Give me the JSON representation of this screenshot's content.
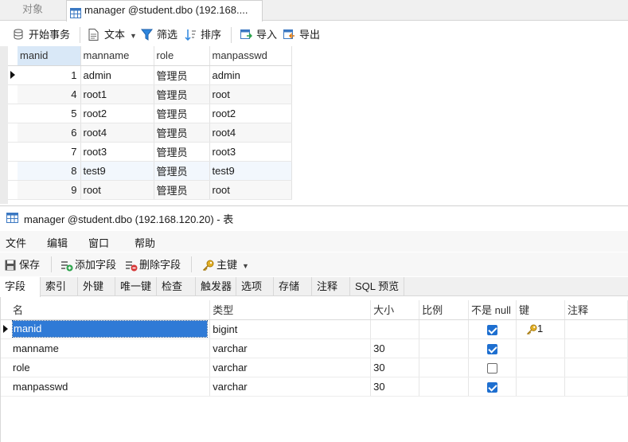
{
  "top_tabs": {
    "objects": "对象",
    "manager": "manager @student.dbo (192.168...."
  },
  "toolbar": {
    "begin_tx": "开始事务",
    "text": "文本",
    "filter": "筛选",
    "sort": "排序",
    "import": "导入",
    "export": "导出"
  },
  "grid": {
    "columns": [
      "manid",
      "manname",
      "role",
      "manpasswd"
    ],
    "rows": [
      [
        "1",
        "admin",
        "管理员",
        "admin"
      ],
      [
        "4",
        "root1",
        "管理员",
        "root"
      ],
      [
        "5",
        "root2",
        "管理员",
        "root2"
      ],
      [
        "6",
        "root4",
        "管理员",
        "root4"
      ],
      [
        "7",
        "root3",
        "管理员",
        "root3"
      ],
      [
        "8",
        "test9",
        "管理员",
        "test9"
      ],
      [
        "9",
        "root",
        "管理员",
        "root"
      ]
    ]
  },
  "design": {
    "title": "manager @student.dbo (192.168.120.20) - 表",
    "menu": [
      "文件",
      "编辑",
      "窗口",
      "帮助"
    ],
    "toolbar": {
      "save": "保存",
      "add_field": "添加字段",
      "delete_field": "删除字段",
      "primary_key": "主键"
    },
    "tabs": [
      "字段",
      "索引",
      "外键",
      "唯一键",
      "检查",
      "触发器",
      "选项",
      "存储",
      "注释",
      "SQL 预览"
    ],
    "field_columns": [
      "名",
      "类型",
      "大小",
      "比例",
      "不是 null",
      "键",
      "注释"
    ],
    "fields": [
      {
        "name": "manid",
        "type": "bigint",
        "size": "",
        "scale": "",
        "not_null": true,
        "key": "1",
        "comment": ""
      },
      {
        "name": "manname",
        "type": "varchar",
        "size": "30",
        "scale": "",
        "not_null": true,
        "key": "",
        "comment": ""
      },
      {
        "name": "role",
        "type": "varchar",
        "size": "30",
        "scale": "",
        "not_null": false,
        "key": "",
        "comment": ""
      },
      {
        "name": "manpasswd",
        "type": "varchar",
        "size": "30",
        "scale": "",
        "not_null": true,
        "key": "",
        "comment": ""
      }
    ]
  },
  "colors": {
    "accent": "#1e6fd0",
    "selection": "#2f7ad6",
    "key_gold": "#d9a520"
  },
  "icons": {
    "table": "table-icon",
    "begin_tx": "transaction-icon",
    "text": "document-icon",
    "filter": "funnel-icon",
    "sort": "sort-icon",
    "import": "import-icon",
    "export": "export-icon",
    "save": "save-icon",
    "add_field": "add-field-icon",
    "delete_field": "delete-field-icon",
    "key": "key-icon"
  }
}
